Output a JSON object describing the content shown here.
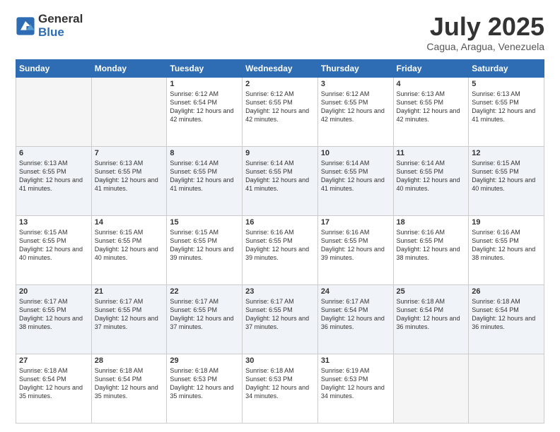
{
  "logo": {
    "general": "General",
    "blue": "Blue"
  },
  "title": "July 2025",
  "location": "Cagua, Aragua, Venezuela",
  "days_of_week": [
    "Sunday",
    "Monday",
    "Tuesday",
    "Wednesday",
    "Thursday",
    "Friday",
    "Saturday"
  ],
  "weeks": [
    [
      {
        "day": "",
        "info": ""
      },
      {
        "day": "",
        "info": ""
      },
      {
        "day": "1",
        "info": "Sunrise: 6:12 AM\nSunset: 6:54 PM\nDaylight: 12 hours and 42 minutes."
      },
      {
        "day": "2",
        "info": "Sunrise: 6:12 AM\nSunset: 6:55 PM\nDaylight: 12 hours and 42 minutes."
      },
      {
        "day": "3",
        "info": "Sunrise: 6:12 AM\nSunset: 6:55 PM\nDaylight: 12 hours and 42 minutes."
      },
      {
        "day": "4",
        "info": "Sunrise: 6:13 AM\nSunset: 6:55 PM\nDaylight: 12 hours and 42 minutes."
      },
      {
        "day": "5",
        "info": "Sunrise: 6:13 AM\nSunset: 6:55 PM\nDaylight: 12 hours and 41 minutes."
      }
    ],
    [
      {
        "day": "6",
        "info": "Sunrise: 6:13 AM\nSunset: 6:55 PM\nDaylight: 12 hours and 41 minutes."
      },
      {
        "day": "7",
        "info": "Sunrise: 6:13 AM\nSunset: 6:55 PM\nDaylight: 12 hours and 41 minutes."
      },
      {
        "day": "8",
        "info": "Sunrise: 6:14 AM\nSunset: 6:55 PM\nDaylight: 12 hours and 41 minutes."
      },
      {
        "day": "9",
        "info": "Sunrise: 6:14 AM\nSunset: 6:55 PM\nDaylight: 12 hours and 41 minutes."
      },
      {
        "day": "10",
        "info": "Sunrise: 6:14 AM\nSunset: 6:55 PM\nDaylight: 12 hours and 41 minutes."
      },
      {
        "day": "11",
        "info": "Sunrise: 6:14 AM\nSunset: 6:55 PM\nDaylight: 12 hours and 40 minutes."
      },
      {
        "day": "12",
        "info": "Sunrise: 6:15 AM\nSunset: 6:55 PM\nDaylight: 12 hours and 40 minutes."
      }
    ],
    [
      {
        "day": "13",
        "info": "Sunrise: 6:15 AM\nSunset: 6:55 PM\nDaylight: 12 hours and 40 minutes."
      },
      {
        "day": "14",
        "info": "Sunrise: 6:15 AM\nSunset: 6:55 PM\nDaylight: 12 hours and 40 minutes."
      },
      {
        "day": "15",
        "info": "Sunrise: 6:15 AM\nSunset: 6:55 PM\nDaylight: 12 hours and 39 minutes."
      },
      {
        "day": "16",
        "info": "Sunrise: 6:16 AM\nSunset: 6:55 PM\nDaylight: 12 hours and 39 minutes."
      },
      {
        "day": "17",
        "info": "Sunrise: 6:16 AM\nSunset: 6:55 PM\nDaylight: 12 hours and 39 minutes."
      },
      {
        "day": "18",
        "info": "Sunrise: 6:16 AM\nSunset: 6:55 PM\nDaylight: 12 hours and 38 minutes."
      },
      {
        "day": "19",
        "info": "Sunrise: 6:16 AM\nSunset: 6:55 PM\nDaylight: 12 hours and 38 minutes."
      }
    ],
    [
      {
        "day": "20",
        "info": "Sunrise: 6:17 AM\nSunset: 6:55 PM\nDaylight: 12 hours and 38 minutes."
      },
      {
        "day": "21",
        "info": "Sunrise: 6:17 AM\nSunset: 6:55 PM\nDaylight: 12 hours and 37 minutes."
      },
      {
        "day": "22",
        "info": "Sunrise: 6:17 AM\nSunset: 6:55 PM\nDaylight: 12 hours and 37 minutes."
      },
      {
        "day": "23",
        "info": "Sunrise: 6:17 AM\nSunset: 6:55 PM\nDaylight: 12 hours and 37 minutes."
      },
      {
        "day": "24",
        "info": "Sunrise: 6:17 AM\nSunset: 6:54 PM\nDaylight: 12 hours and 36 minutes."
      },
      {
        "day": "25",
        "info": "Sunrise: 6:18 AM\nSunset: 6:54 PM\nDaylight: 12 hours and 36 minutes."
      },
      {
        "day": "26",
        "info": "Sunrise: 6:18 AM\nSunset: 6:54 PM\nDaylight: 12 hours and 36 minutes."
      }
    ],
    [
      {
        "day": "27",
        "info": "Sunrise: 6:18 AM\nSunset: 6:54 PM\nDaylight: 12 hours and 35 minutes."
      },
      {
        "day": "28",
        "info": "Sunrise: 6:18 AM\nSunset: 6:54 PM\nDaylight: 12 hours and 35 minutes."
      },
      {
        "day": "29",
        "info": "Sunrise: 6:18 AM\nSunset: 6:53 PM\nDaylight: 12 hours and 35 minutes."
      },
      {
        "day": "30",
        "info": "Sunrise: 6:18 AM\nSunset: 6:53 PM\nDaylight: 12 hours and 34 minutes."
      },
      {
        "day": "31",
        "info": "Sunrise: 6:19 AM\nSunset: 6:53 PM\nDaylight: 12 hours and 34 minutes."
      },
      {
        "day": "",
        "info": ""
      },
      {
        "day": "",
        "info": ""
      }
    ]
  ]
}
